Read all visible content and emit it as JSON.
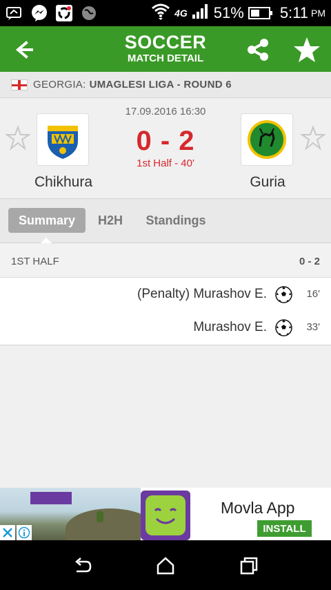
{
  "status_bar": {
    "battery": "51%",
    "time": "5:11",
    "ampm": "PM",
    "network": "4G",
    "icons": [
      "chat-bubble-icon",
      "messenger-icon",
      "sync-icon",
      "globe-icon",
      "wifi-icon",
      "signal-icon",
      "battery-icon"
    ]
  },
  "app_bar": {
    "title": "SOCCER",
    "subtitle": "MATCH DETAIL",
    "background": "#3a9a27"
  },
  "league": {
    "country": "GEORGIA:",
    "name": "UMAGLESI LIGA - ROUND 6"
  },
  "match": {
    "datetime": "17.09.2016 16:30",
    "score": "0 - 2",
    "status": "1st Half - 40'",
    "home_team": "Chikhura",
    "away_team": "Guria",
    "score_color": "#d6282d"
  },
  "tabs": [
    {
      "label": "Summary",
      "active": true
    },
    {
      "label": "H2H",
      "active": false
    },
    {
      "label": "Standings",
      "active": false
    }
  ],
  "summary": {
    "half_label": "1ST HALF",
    "half_score": "0 - 2",
    "events": [
      {
        "player": "(Penalty) Murashov E.",
        "minute": "16'",
        "icon": "soccer-ball-icon"
      },
      {
        "player": "Murashov E.",
        "minute": "33'",
        "icon": "soccer-ball-icon"
      }
    ]
  },
  "ad": {
    "title": "Movla App",
    "install_label": "INSTALL"
  }
}
